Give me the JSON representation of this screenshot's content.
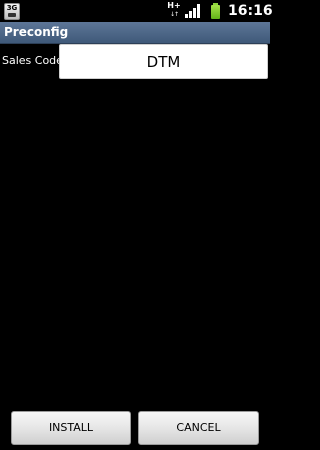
{
  "status_bar": {
    "sim_label": "3G",
    "network_type": "H+",
    "network_arrows": "↓↑",
    "time": "16:16",
    "battery_color": "#8cd43a",
    "icons": {
      "sim": "sim-card-icon",
      "network": "network-activity-icon",
      "signal": "signal-strength-icon",
      "battery": "battery-icon"
    }
  },
  "title_bar": {
    "title": "Preconfig",
    "background_color": "#4d6788"
  },
  "form": {
    "sales_code_label": "Sales Code",
    "sales_code_value": "DTM"
  },
  "buttons": {
    "install_label": "INSTALL",
    "cancel_label": "CANCEL"
  }
}
